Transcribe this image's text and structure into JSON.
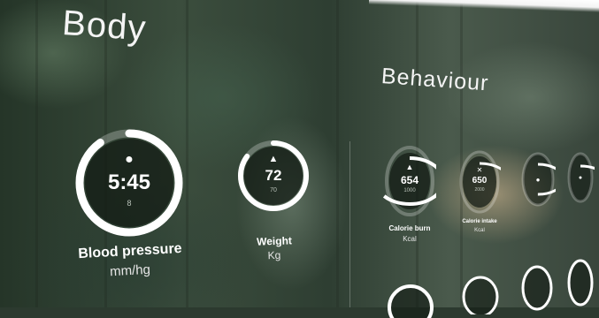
{
  "sections": {
    "body_title": "Body",
    "behaviour_title": "Behaviour"
  },
  "body_metrics": [
    {
      "value": "5:45",
      "sub": "8",
      "label": "Blood pressure",
      "unit": "mm/hg",
      "icon": "drop-icon",
      "progress": 0.9
    },
    {
      "value": "72",
      "sub": "70",
      "label": "Weight",
      "unit": "Kg",
      "icon": "weight-icon",
      "progress": 0.85
    }
  ],
  "behaviour_metrics": [
    {
      "value": "654",
      "sub": "1000",
      "label": "Calorie burn",
      "unit": "Kcal",
      "icon": "flame-icon",
      "progress": 0.65
    },
    {
      "value": "650",
      "sub": "2000",
      "label": "Calorie intake",
      "unit": "Kcal",
      "icon": "utensils-icon",
      "progress": 0.35
    },
    {
      "icon": "activity-icon",
      "progress": 0.5
    },
    {
      "icon": "activity-icon",
      "progress": 0.3
    }
  ]
}
